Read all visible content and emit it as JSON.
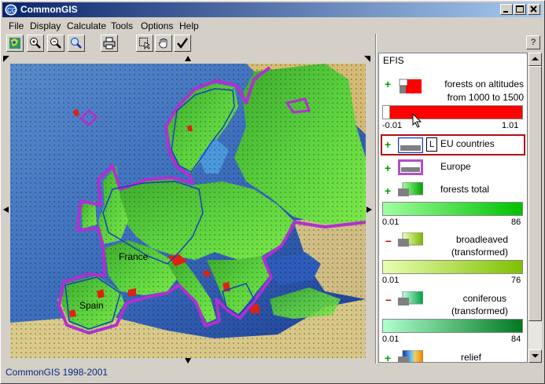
{
  "window": {
    "title": "CommonGIS"
  },
  "menu": [
    "File",
    "Display",
    "Calculate",
    "Tools",
    "Options",
    "Help"
  ],
  "toolbar": {
    "tools": [
      "globe-icon",
      "zoom-in-icon",
      "zoom-out-icon",
      "zoom-extent-icon",
      "print-icon",
      "select-icon",
      "pan-hand-icon",
      "check-icon"
    ]
  },
  "help_label": "?",
  "legend": {
    "title": "EFIS",
    "layers": [
      {
        "name_line1": "forests on altitudes",
        "name_line2": "from 1000 to 1500",
        "min": "-0.01",
        "max": "1.01",
        "color": "#ff0000"
      },
      {
        "name": "EU countries",
        "l_badge": "L"
      },
      {
        "name": "Europe",
        "color": "#b050c8"
      },
      {
        "name": "forests total",
        "min": "0.01",
        "max": "86",
        "color_from": "#a0ffa0",
        "color_to": "#00c000"
      },
      {
        "name_line1": "broadleaved",
        "name_line2": "(transformed)",
        "min": "0.01",
        "max": "76",
        "color_from": "#e8ffb0",
        "color_to": "#80c000"
      },
      {
        "name_line1": "coniferous",
        "name_line2": "(transformed)",
        "min": "0.01",
        "max": "84",
        "color_from": "#b0ffd0",
        "color_to": "#007820"
      },
      {
        "name": "relief"
      }
    ]
  },
  "map_labels": {
    "france": "France",
    "spain": "Spain"
  },
  "status": "CommonGIS 1998-2001"
}
